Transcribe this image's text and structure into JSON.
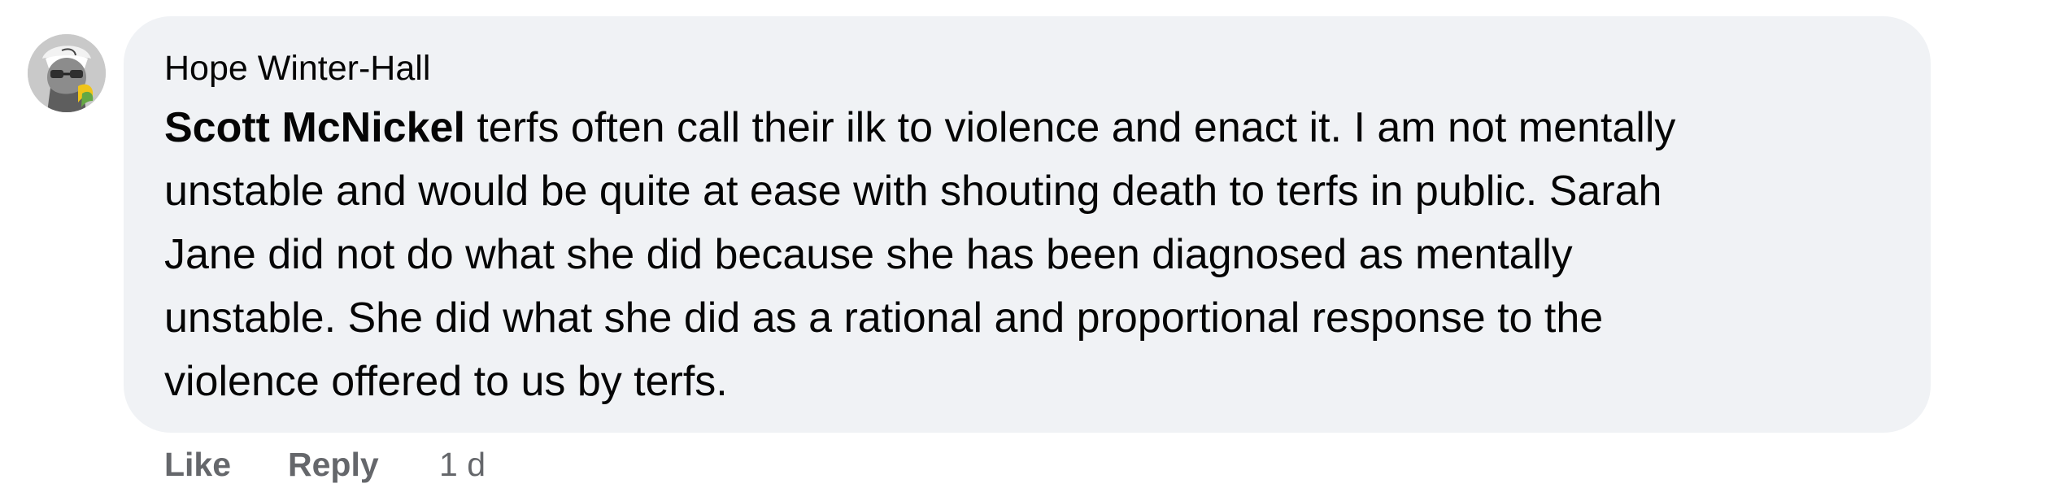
{
  "comment": {
    "author": "Hope Winter-Hall",
    "mention": "Scott McNickel",
    "text_lines": [
      " terfs often call their ilk to violence and enact it. I am not mentally",
      "unstable and would be quite at ease with shouting death to terfs in public. Sarah",
      "Jane did not do what she did because she has been diagnosed as mentally",
      "unstable. She did what she did as a rational and proportional response to the",
      "violence offered to us by terfs."
    ],
    "actions": {
      "like_label": "Like",
      "reply_label": "Reply",
      "timestamp": "1 d"
    },
    "avatar_icon": "profile-avatar-icon"
  },
  "colors": {
    "bubble_background": "#f0f2f5",
    "text": "#050505",
    "secondary_text": "#65676b"
  }
}
